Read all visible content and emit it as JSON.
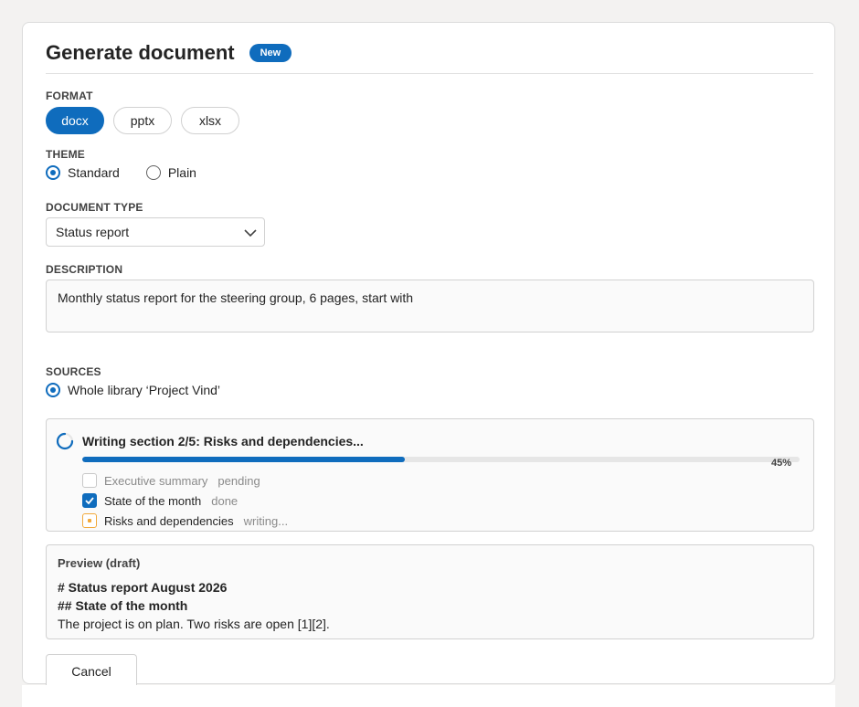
{
  "dialog": {
    "title": "Generate document",
    "badge": "New"
  },
  "format": {
    "label": "FORMAT",
    "options": [
      "docx",
      "pptx",
      "xlsx"
    ],
    "selected": "docx"
  },
  "theme": {
    "label": "THEME",
    "options": [
      {
        "label": "Standard",
        "checked": true
      },
      {
        "label": "Plain",
        "checked": false
      }
    ]
  },
  "document_type": {
    "label": "DOCUMENT TYPE",
    "value": "Status report"
  },
  "description": {
    "label": "DESCRIPTION",
    "value": "Monthly status report for the steering group, 6 pages, start with"
  },
  "sources": {
    "label": "SOURCES",
    "option": "Whole library ‘Project Vind’"
  },
  "progress": {
    "title": "Writing section 2/5: Risks and dependencies...",
    "percent_label": "45%",
    "fraction": 0.45,
    "tasks": [
      {
        "name": "Executive summary",
        "status": "pending"
      },
      {
        "name": "State of the month",
        "status": "done"
      },
      {
        "name": "Risks and dependencies",
        "status": "writing..."
      }
    ]
  },
  "preview": {
    "label": "Preview (draft)",
    "lines": [
      "# Status report August 2026",
      "## State of the month",
      "The project is on plan. Two risks are open [1][2]."
    ]
  },
  "actions": {
    "cancel_label": "Cancel"
  },
  "colors": {
    "accent": "#0f6cbd",
    "writing": "#f2a93b"
  }
}
